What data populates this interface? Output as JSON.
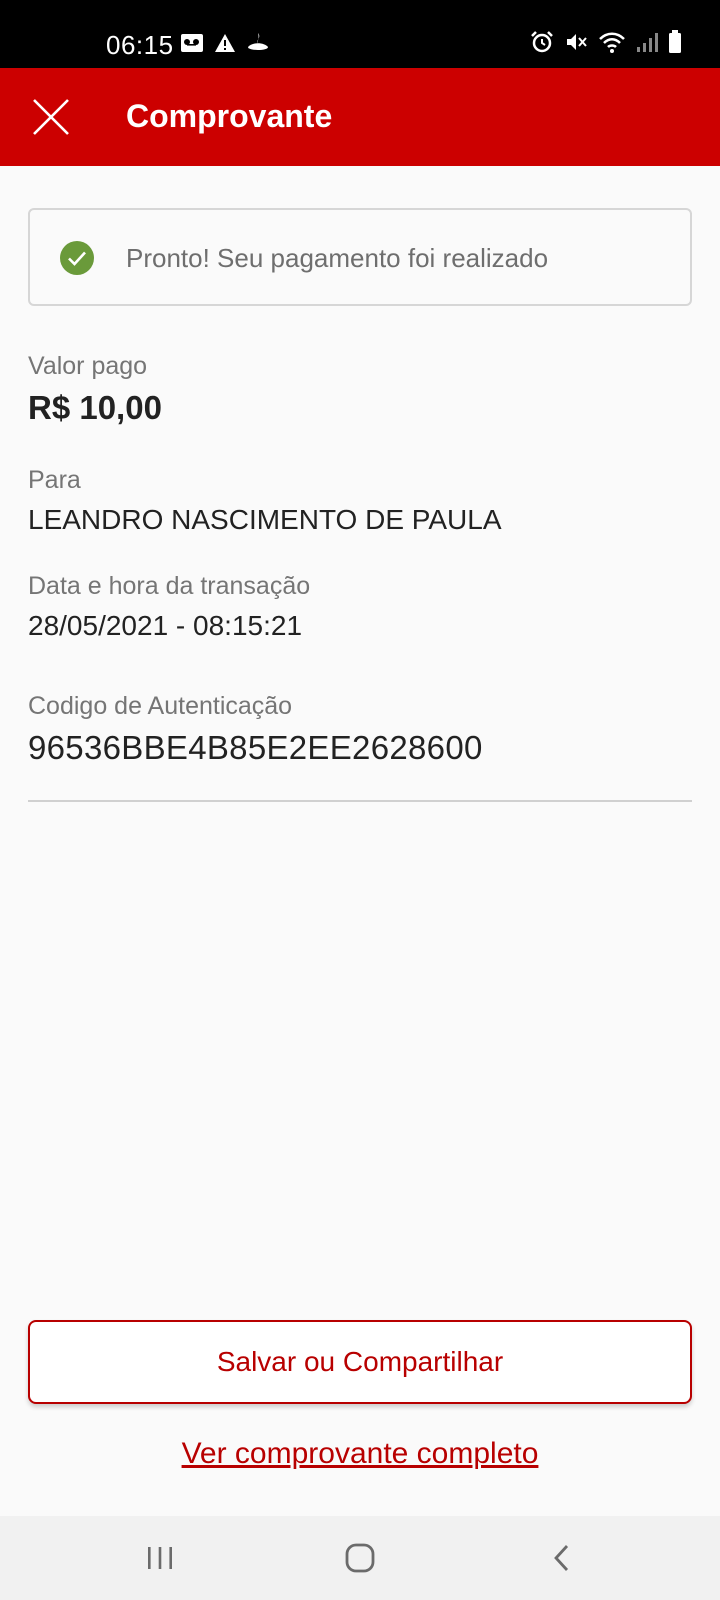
{
  "status_bar": {
    "time": "06:15",
    "left_icons": [
      "voicemail-icon",
      "warning-icon",
      "santander-flame-icon"
    ],
    "right_icons": [
      "alarm-icon",
      "mute-icon",
      "wifi-icon",
      "signal-icon",
      "battery-icon"
    ]
  },
  "header": {
    "title": "Comprovante",
    "close_icon": "close-icon",
    "background_color": "#cc0000"
  },
  "success_banner": {
    "message": "Pronto! Seu pagamento foi realizado",
    "icon": "check-circle-icon",
    "icon_color": "#6a9a3a"
  },
  "details": {
    "amount_label": "Valor pago",
    "amount_value": "R$ 10,00",
    "recipient_label": "Para",
    "recipient_value": "LEANDRO NASCIMENTO DE PAULA",
    "datetime_label": "Data e hora da transação",
    "datetime_value": "28/05/2021 - 08:15:21",
    "auth_label": "Codigo de Autenticação",
    "auth_value": "96536BBE4B85E2EE2628600"
  },
  "actions": {
    "save_share_label": "Salvar ou Compartilhar",
    "full_receipt_label": "Ver comprovante completo",
    "accent_color": "#b80000"
  },
  "nav_bar": {
    "icons": [
      "recent-apps-icon",
      "home-icon",
      "back-icon"
    ]
  }
}
